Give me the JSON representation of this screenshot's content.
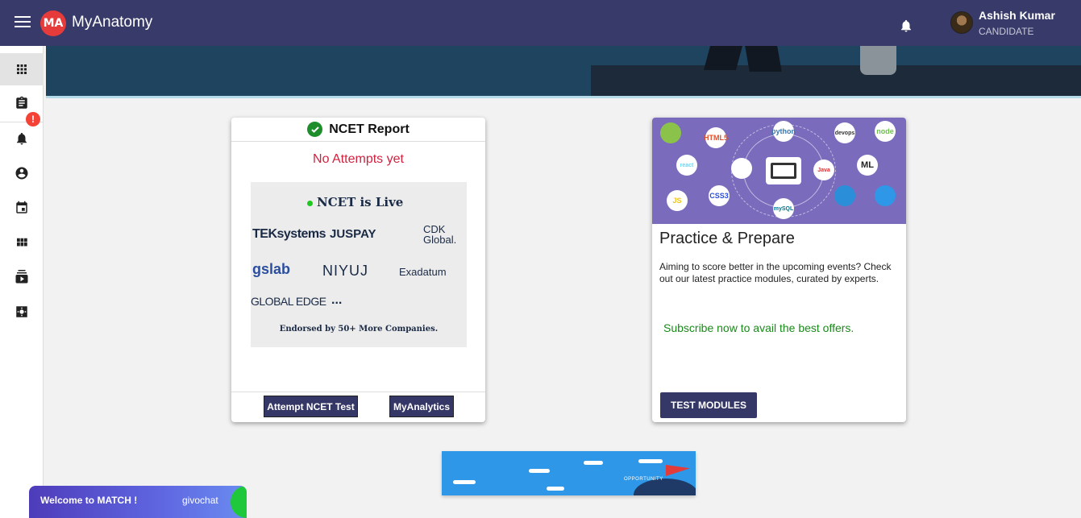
{
  "app": {
    "brand": "MyAnatomy",
    "logo_text": "MA"
  },
  "user": {
    "name": "Ashish Kumar",
    "role": "CANDIDATE"
  },
  "sidebar": {
    "items": [
      {
        "icon": "dashboard-grid-icon"
      },
      {
        "icon": "clipboard-icon"
      },
      {
        "icon": "bell-icon"
      },
      {
        "icon": "account-circle-icon"
      },
      {
        "icon": "calendar-icon"
      },
      {
        "icon": "apps-icon"
      },
      {
        "icon": "video-library-icon"
      },
      {
        "icon": "settings-icon"
      }
    ],
    "profile_badge": "!"
  },
  "ncet_card": {
    "title": "NCET Report",
    "status": "No Attempts yet",
    "image": {
      "headline": "NCET is Live",
      "companies": [
        "TEKsystems",
        "JUSPAY",
        "CDK Global.",
        "gslab",
        "NIYUJ",
        "Exadatum",
        "GLOBAL EDGE",
        "..."
      ],
      "endorsed": "Endorsed by 50+ More Companies."
    },
    "buttons": {
      "attempt": "Attempt NCET Test",
      "analytics": "MyAnalytics"
    }
  },
  "practice_card": {
    "title": "Practice & Prepare",
    "description": "Aiming to score better in the upcoming events? Check out our latest practice modules, curated by experts.",
    "offer": "Subscribe now to avail the best offers.",
    "button": "TEST MODULES",
    "tech_badges": [
      "ML",
      "node",
      "HTML5",
      "CSS3",
      "JS",
      "Java",
      "python",
      "devops",
      "mySQL",
      "react"
    ]
  },
  "bottom_banner": {
    "label": "OPPORTUNITY"
  },
  "chat": {
    "welcome": "Welcome to MATCH !",
    "brand": "givochat"
  },
  "colors": {
    "topbar": "#383a69",
    "button": "#353767",
    "status_red": "#d0223f",
    "offer_green": "#1a8a1a"
  }
}
